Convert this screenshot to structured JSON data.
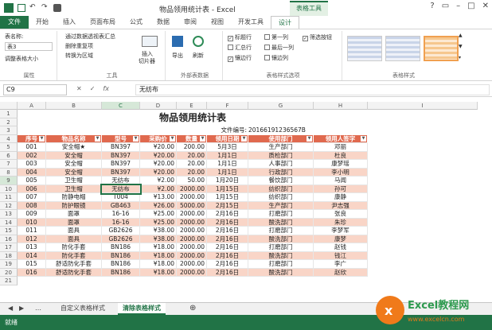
{
  "window": {
    "title": "物品领用统计表 - Excel",
    "context_tab": "表格工具"
  },
  "tabs": [
    "文件",
    "开始",
    "插入",
    "页面布局",
    "公式",
    "数据",
    "审阅",
    "视图",
    "开发工具",
    "设计"
  ],
  "ribbon": {
    "props": {
      "name_label": "表名称:",
      "name_value": "表3",
      "resize": "调整表格大小",
      "group": "属性"
    },
    "tools": {
      "pivot": "通过数据透视表汇总",
      "dedupe": "删除重复项",
      "convert": "转换为区域",
      "slicer_line1": "插入",
      "slicer_line2": "切片器",
      "group": "工具"
    },
    "ext": {
      "export": "导出",
      "refresh": "刷新",
      "group": "外部表数据"
    },
    "opts": {
      "header_row": "标题行",
      "total_row": "汇总行",
      "banded_rows": "镶边行",
      "first_col": "第一列",
      "last_col": "最后一列",
      "banded_cols": "镶边列",
      "filter_btn": "筛选按钮",
      "group": "表格样式选项"
    },
    "styles": {
      "group": "表格样式"
    }
  },
  "formula": {
    "name_box": "C9",
    "fx": "fx",
    "value": "无纺布"
  },
  "columns": [
    "A",
    "B",
    "C",
    "D",
    "E",
    "F",
    "G",
    "H",
    "I"
  ],
  "sheet": {
    "title": "物品领用统计表",
    "doc_label": "文件编号:",
    "doc_no": "20166191236567B",
    "headers": [
      "序号",
      "物品名称",
      "型号",
      "采购价",
      "数量",
      "领用日期",
      "使用部门",
      "领用人签字"
    ],
    "rows": [
      [
        "001",
        "安全帽★",
        "BN397",
        "¥20.00",
        "200.00",
        "5月3日",
        "生产部门",
        "邓丽"
      ],
      [
        "002",
        "安全帽",
        "BN397",
        "¥20.00",
        "20.00",
        "1月1日",
        "质检部门",
        "杜良"
      ],
      [
        "003",
        "安全帽",
        "BN397",
        "¥20.00",
        "20.00",
        "1月1日",
        "人事部门",
        "康梦瑶"
      ],
      [
        "004",
        "安全帽",
        "BN397",
        "¥20.00",
        "20.00",
        "1月1日",
        "行政部门",
        "李小明"
      ],
      [
        "005",
        "卫生帽",
        "无纺布",
        "¥2.00",
        "50.00",
        "1月20日",
        "餐饮部门",
        "马闻"
      ],
      [
        "006",
        "卫生帽",
        "无纺布",
        "¥2.00",
        "2000.00",
        "1月15日",
        "纺织部门",
        "孙可"
      ],
      [
        "007",
        "防静电帽",
        "T004",
        "¥13.00",
        "2000.00",
        "1月15日",
        "纺织部门",
        "康静"
      ],
      [
        "008",
        "防护眼镜",
        "GB463",
        "¥26.00",
        "5000.00",
        "2月15日",
        "生产部门",
        "尹志强"
      ],
      [
        "009",
        "面罩",
        "16-16",
        "¥25.00",
        "2000.00",
        "2月16日",
        "打磨部门",
        "张良"
      ],
      [
        "010",
        "面罩",
        "16-16",
        "¥25.00",
        "2000.00",
        "2月16日",
        "酸洗部门",
        "朱珍"
      ],
      [
        "011",
        "面具",
        "GB2626",
        "¥38.00",
        "2000.00",
        "2月16日",
        "打磨部门",
        "李梦军"
      ],
      [
        "012",
        "面具",
        "GB2626",
        "¥38.00",
        "2000.00",
        "2月16日",
        "酸洗部门",
        "康梦"
      ],
      [
        "013",
        "防化手套",
        "BN186",
        "¥18.00",
        "2000.00",
        "2月16日",
        "打磨部门",
        "赵钱"
      ],
      [
        "014",
        "防化手套",
        "BN186",
        "¥18.00",
        "2000.00",
        "2月16日",
        "酸洗部门",
        "钱江"
      ],
      [
        "015",
        "舒适防化手套",
        "BN186",
        "¥18.00",
        "2000.00",
        "2月16日",
        "打磨部门",
        "李广"
      ],
      [
        "016",
        "舒适防化手套",
        "BN186",
        "¥18.00",
        "2000.00",
        "2月16日",
        "酸洗部门",
        "赵欣"
      ]
    ]
  },
  "sheet_tabs": [
    "自定义表格样式",
    "清除表格样式"
  ],
  "status": "就绪",
  "watermark": {
    "line1": "Excel教程网",
    "line2": "www.excelcn.com"
  },
  "colors": {
    "excel_green": "#217346",
    "header_orange": "#e0694e",
    "band_peach": "#f9d5c7"
  }
}
